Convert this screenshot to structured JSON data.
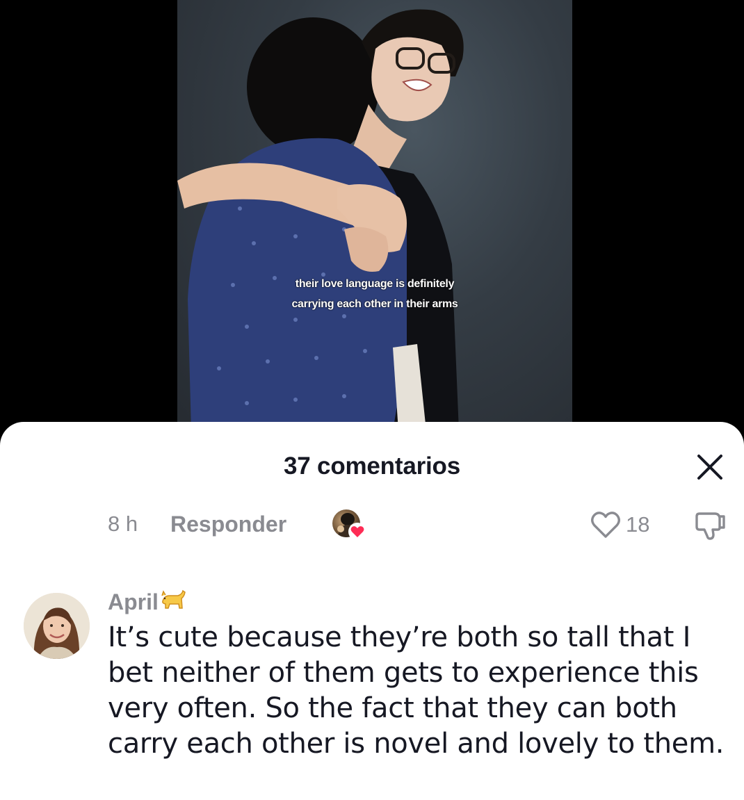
{
  "video": {
    "caption_line1": "their love language is definitely",
    "caption_line2": "carrying each other in their arms"
  },
  "sheet": {
    "title": "37 comentarios",
    "close_icon": "close-icon"
  },
  "previous_comment_meta": {
    "time": "8 h",
    "reply_label": "Responder",
    "like_count": "18",
    "like_icon": "heart-outline-icon",
    "dislike_icon": "thumbs-down-icon",
    "creator_liked_icon": "creator-heart-icon"
  },
  "comment": {
    "username": "April",
    "username_emoji": "cat-emoji",
    "text": "It’s cute because they’re both so tall that I bet neither of them gets to experience this very often. So the fact that they can both carry each other is novel and lovely to them."
  },
  "colors": {
    "primary_text": "#161823",
    "secondary_text": "#8a8b91",
    "like_heart": "#fe2c55",
    "sheet_bg": "#ffffff"
  }
}
